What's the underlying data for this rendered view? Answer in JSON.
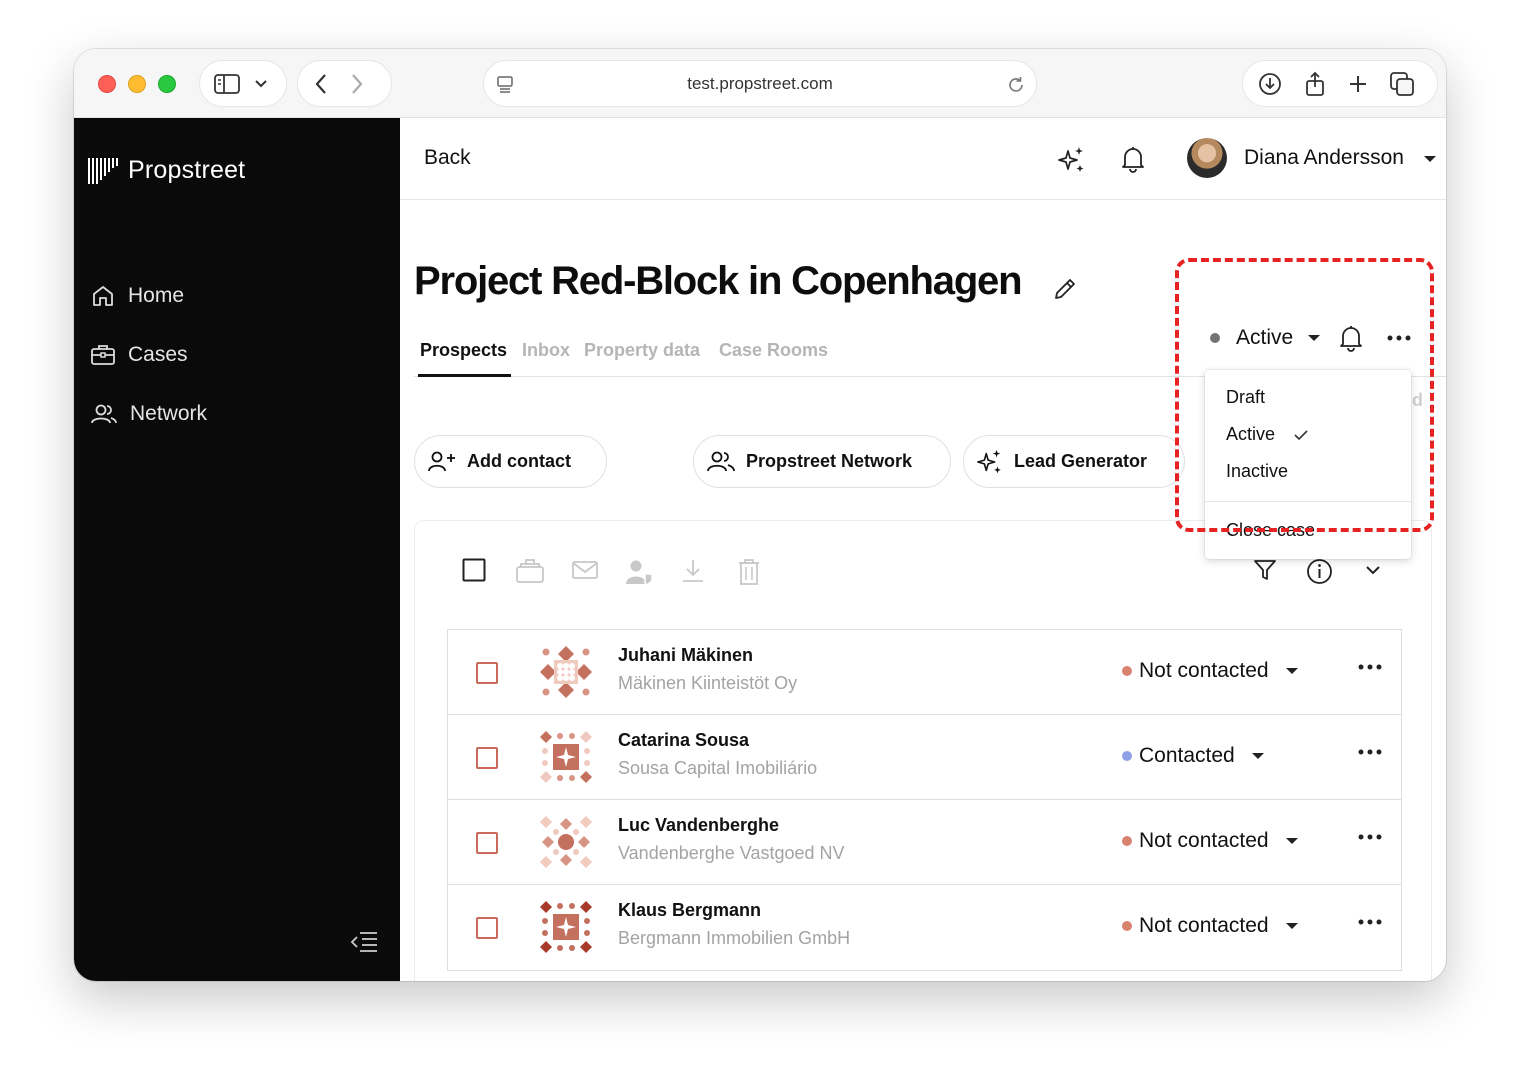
{
  "browser": {
    "url": "test.propstreet.com"
  },
  "sidebar": {
    "brand": "Propstreet",
    "items": [
      {
        "label": "Home",
        "icon": "home-icon"
      },
      {
        "label": "Cases",
        "icon": "briefcase-icon"
      },
      {
        "label": "Network",
        "icon": "people-icon"
      }
    ]
  },
  "header": {
    "back_label": "Back",
    "user_name": "Diana Andersson"
  },
  "project": {
    "title": "Project Red-Block in Copenhagen",
    "tabs": [
      "Prospects",
      "Inbox",
      "Property data",
      "Case Rooms"
    ],
    "active_tab": "Prospects",
    "status": "Active",
    "status_color": "#737373"
  },
  "status_menu": {
    "items": [
      "Draft",
      "Active",
      "Inactive"
    ],
    "selected": "Active",
    "close_case": "Close case"
  },
  "actions": {
    "add_contact": "Add contact",
    "propstreet_network": "Propstreet Network",
    "lead_generator": "Lead Generator"
  },
  "prospects": [
    {
      "name": "Juhani Mäkinen",
      "company": "Mäkinen Kiinteistöt Oy",
      "status": "Not contacted",
      "status_color": "#d9826e"
    },
    {
      "name": "Catarina Sousa",
      "company": "Sousa Capital Imobiliário",
      "status": "Contacted",
      "status_color": "#8da0e8"
    },
    {
      "name": "Luc Vandenberghe",
      "company": "Vandenberghe Vastgoed NV",
      "status": "Not contacted",
      "status_color": "#d9826e"
    },
    {
      "name": "Klaus Bergmann",
      "company": "Bergmann Immobilien GmbH",
      "status": "Not contacted",
      "status_color": "#d9826e"
    }
  ],
  "colors": {
    "accent_logo": "#d97a66",
    "highlight": "#e62222"
  }
}
